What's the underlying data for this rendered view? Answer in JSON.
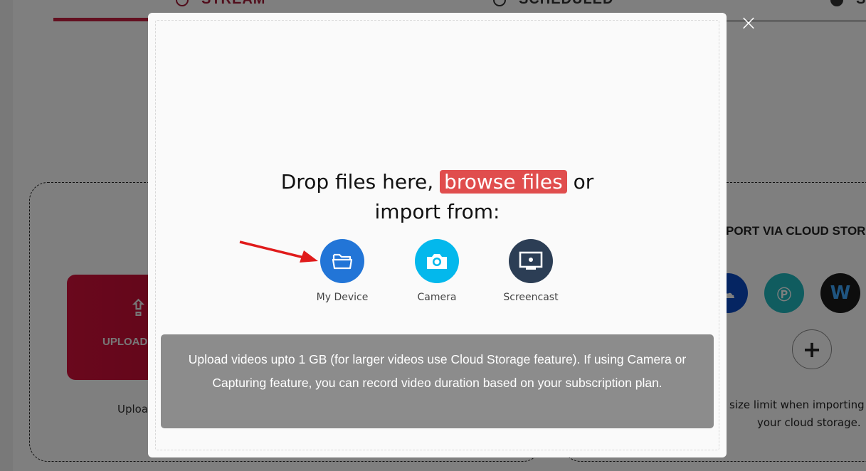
{
  "background": {
    "tabs": [
      {
        "label": "STREAM",
        "icon": "clock-icon",
        "active": true
      },
      {
        "label": "SCHEDULED",
        "icon": "clock-icon",
        "active": false
      },
      {
        "label": "S",
        "icon": "gear-icon",
        "active": false
      }
    ],
    "upload_card": {
      "button_label": "UPLOAD",
      "note": "Uploa"
    },
    "cloud_card": {
      "title": "PORT VIA CLOUD STOR",
      "providers": [
        {
          "name": "OneDrive",
          "icon": "onedrive-icon",
          "color": "#0a4bc4"
        },
        {
          "name": "pCloud",
          "icon": "pcloud-icon",
          "color": "#20b8bf"
        },
        {
          "name": "Webex",
          "icon": "webex-icon",
          "color": "#1b1b1b"
        }
      ],
      "add_label": "+",
      "note_line1": "size limit when importing",
      "note_line2": "your cloud storage."
    }
  },
  "modal": {
    "close_label": "×",
    "drop_text_before": "Drop files here, ",
    "browse_label": "browse files",
    "drop_text_after": " or",
    "drop_text_line2": "import from:",
    "sources": [
      {
        "label": "My Device",
        "icon": "folder-icon",
        "color": "#2275d7"
      },
      {
        "label": "Camera",
        "icon": "camera-icon",
        "color": "#03b8ec"
      },
      {
        "label": "Screencast",
        "icon": "monitor-icon",
        "color": "#2c3e55"
      }
    ],
    "info_text": "Upload videos upto 1 GB (for larger videos use Cloud Storage feature). If using Camera or Capturing feature, you can record video duration based on your subscription plan."
  },
  "colors": {
    "accent": "#c72141",
    "browse": "#e04d4d",
    "annotation_arrow": "#e01b1b"
  }
}
